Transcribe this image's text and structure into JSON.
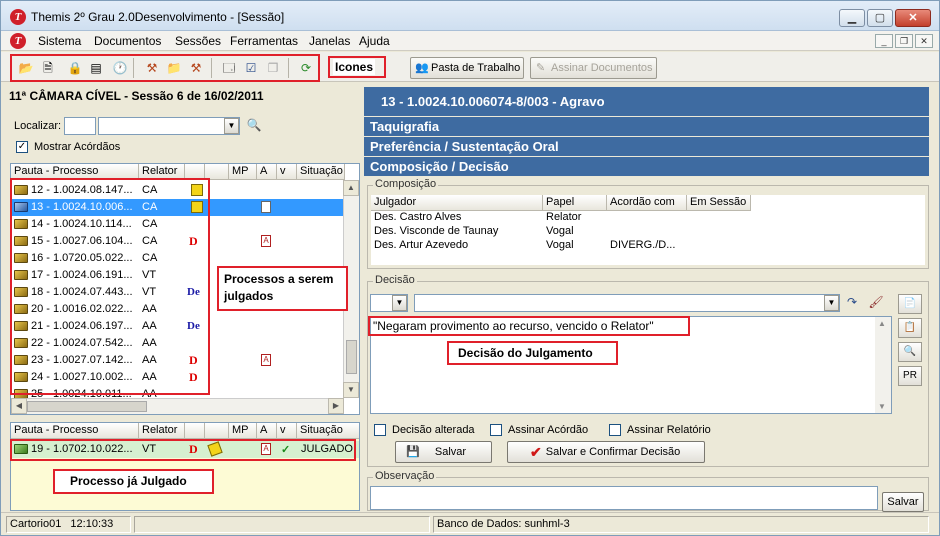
{
  "window": {
    "title": "Themis 2º Grau 2.0Desenvolvimento - [Sessão]",
    "logo_letter": "T",
    "minimize": "▁",
    "maximize": "▢",
    "close": "✕"
  },
  "menu": [
    "Sistema",
    "Documentos",
    "Sessões",
    "Ferramentas",
    "Janelas",
    "Ajuda"
  ],
  "mdi_buttons": [
    "_",
    "❐",
    "✕"
  ],
  "toolbar": {
    "pasta_label": "Pasta de Trabalho",
    "assinar_label": "Assinar Documentos"
  },
  "annotations": {
    "icones": "Icones",
    "processos": "Processos a serem julgados",
    "decisao": "Decisão do Julgamento",
    "julgado": "Processo já Julgado"
  },
  "session": {
    "header": "11ª  CÂMARA CÍVEL - Sessão 6 de 16/02/2011",
    "localizar_label": "Localizar:",
    "mostrar_label": "Mostrar Acórdãos",
    "mostrar_checked": "✓"
  },
  "pauta": {
    "columns": [
      "Pauta - Processo",
      "Relator",
      "MP",
      "A",
      "v",
      "Situação"
    ],
    "rows": [
      {
        "processo": "12 - 1.0024.08.147...",
        "relator": "CA",
        "mark": "y",
        "a": ""
      },
      {
        "processo": "13 - 1.0024.10.006...",
        "relator": "CA",
        "mark": "y",
        "a": "r"
      },
      {
        "processo": "14 - 1.0024.10.114...",
        "relator": "CA",
        "mark": "",
        "a": ""
      },
      {
        "processo": "15 - 1.0027.06.104...",
        "relator": "CA",
        "mark": "D",
        "a": "A"
      },
      {
        "processo": "16 - 1.0720.05.022...",
        "relator": "CA",
        "mark": "",
        "a": ""
      },
      {
        "processo": "17 - 1.0024.06.191...",
        "relator": "VT",
        "mark": "",
        "a": ""
      },
      {
        "processo": "18 - 1.0024.07.443...",
        "relator": "VT",
        "mark": "De",
        "a": ""
      },
      {
        "processo": "20 - 1.0016.02.022...",
        "relator": "AA",
        "mark": "",
        "a": ""
      },
      {
        "processo": "21 - 1.0024.06.197...",
        "relator": "AA",
        "mark": "De",
        "a": ""
      },
      {
        "processo": "22 - 1.0024.07.542...",
        "relator": "AA",
        "mark": "",
        "a": ""
      },
      {
        "processo": "23 - 1.0027.07.142...",
        "relator": "AA",
        "mark": "D",
        "a": "A"
      },
      {
        "processo": "24 - 1.0027.10.002...",
        "relator": "AA",
        "mark": "D",
        "a": ""
      },
      {
        "processo": "25 - 1.0024.10.011...",
        "relator": "AA",
        "mark": "",
        "a": ""
      }
    ]
  },
  "julgados": {
    "columns": [
      "Pauta - Processo",
      "Relator",
      "MP",
      "A",
      "v",
      "Situação"
    ],
    "row": {
      "processo": "19 - 1.0702.10.022...",
      "relator": "VT",
      "mark": "D",
      "a": "A",
      "v": "✓",
      "situacao": "JULGADO"
    }
  },
  "processo": {
    "header": "13   -   1.0024.10.006074-8/003 - Agravo",
    "bands": [
      "Taquigrafia",
      "Preferência / Sustentação Oral",
      "Composição / Decisão"
    ]
  },
  "composicao": {
    "title": "Composição",
    "columns": [
      "Julgador",
      "Papel",
      "Acordão com",
      "Em Sessão"
    ],
    "rows": [
      {
        "julgador": "Des. Castro Alves",
        "papel": "Relator",
        "acordao": "",
        "sessao": ""
      },
      {
        "julgador": "Des. Visconde de Taunay",
        "papel": "Vogal",
        "acordao": "",
        "sessao": ""
      },
      {
        "julgador": "Des. Artur Azevedo",
        "papel": "Vogal",
        "acordao": "DIVERG./D...",
        "sessao": ""
      }
    ]
  },
  "decisao": {
    "title": "Decisão",
    "text": "\"Negaram  provimento ao recurso, vencido o Relator\"",
    "side_buttons": [
      "📄",
      "📋",
      "🔍",
      "PR"
    ],
    "checks": [
      "Decisão alterada",
      "Assinar Acórdão",
      "Assinar Relatório"
    ],
    "salvar": "Salvar",
    "salvar_confirmar": "Salvar e Confirmar Decisão"
  },
  "observacao": {
    "title": "Observação",
    "salvar": "Salvar"
  },
  "status": {
    "user": "Cartorio01",
    "time": "12:10:33",
    "db": "Banco de Dados: sunhml-3"
  }
}
